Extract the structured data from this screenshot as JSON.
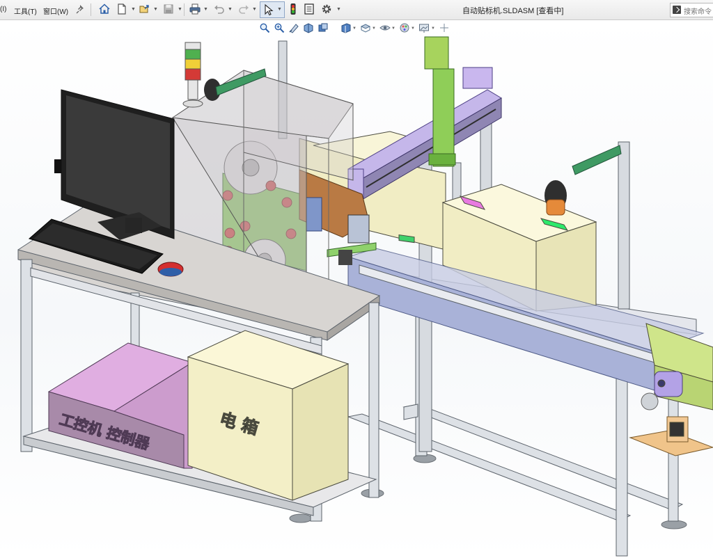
{
  "menu": {
    "fragment": "(I)",
    "tools": "工具(T)",
    "window": "窗口(W)"
  },
  "toolbar": {
    "icons": [
      "pin-icon",
      "home-icon",
      "new-document-icon",
      "open-icon",
      "save-icon",
      "print-icon",
      "undo-icon",
      "redo-icon",
      "select-arrow-icon",
      "traffic-light-icon",
      "file-properties-icon",
      "options-gear-icon"
    ]
  },
  "document": {
    "title": "自动贴标机.SLDASM [查看中]"
  },
  "search": {
    "placeholder": "搜索命令"
  },
  "heads_up_toolbar": {
    "icons": [
      "zoom-to-fit-icon",
      "zoom-to-area-icon",
      "previous-view-icon",
      "section-view-icon",
      "dynamic-annotation-icon",
      "view-orientation-icon",
      "display-style-icon",
      "hide-show-items-icon",
      "edit-appearance-icon",
      "apply-scene-icon",
      "view-settings-icon"
    ]
  },
  "model": {
    "box_left_label": "工控机 控制器",
    "box_right_label": "电 箱",
    "colors": {
      "frame": "#d9dde3",
      "conveyor_belt": "#aab3d8",
      "carton": "#f3efc7",
      "controller_box": "#d8a0d6",
      "guard_glass": "#c9c6c8",
      "green_parts": "#8fd16b",
      "lavender_parts": "#c7b3e8"
    }
  }
}
